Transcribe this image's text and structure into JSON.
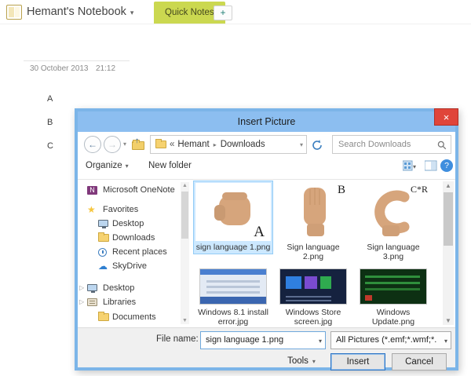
{
  "colors": {
    "dialog_frame": "#7cb5e8",
    "titlebar": "#8cbef0",
    "close_red": "#e0453a",
    "selection": "#cce8ff",
    "section_tab": "#cbd850",
    "onenote_purple": "#80397b"
  },
  "glyphs": {
    "back": "←",
    "forward": "→",
    "up": "↑",
    "dropdown": "▾",
    "chevron": "▸",
    "guillemet": "«",
    "star": "★",
    "cloud": "☁",
    "close": "×",
    "plus": "+",
    "help": "?",
    "scroll_up": "▲",
    "scroll_down": "▼",
    "expander": "▷",
    "onenote_n": "N"
  },
  "app": {
    "notebook_title": "Hemant's Notebook",
    "section_tab": "Quick Notes",
    "date": "30 October 2013",
    "time": "21:12",
    "outline_items": [
      "A",
      "B",
      "C"
    ]
  },
  "dialog": {
    "title": "Insert Picture",
    "nav": {
      "breadcrumb_items": [
        "Hemant",
        "Downloads"
      ],
      "search_placeholder": "Search Downloads"
    },
    "toolbar": {
      "organize": "Organize",
      "new_folder": "New folder"
    },
    "sidebar": {
      "items": [
        {
          "label": "Microsoft OneNote",
          "icon": "onenote"
        },
        {
          "label": "Favorites",
          "icon": "star"
        },
        {
          "label": "Desktop",
          "icon": "monitor"
        },
        {
          "label": "Downloads",
          "icon": "folder"
        },
        {
          "label": "Recent places",
          "icon": "clock"
        },
        {
          "label": "SkyDrive",
          "icon": "cloud"
        },
        {
          "label": "Desktop",
          "icon": "monitor"
        },
        {
          "label": "Libraries",
          "icon": "library"
        },
        {
          "label": "Documents",
          "icon": "folder"
        }
      ]
    },
    "files": [
      {
        "name": "sign language 1.png",
        "letter": "A",
        "selected": true
      },
      {
        "name": "Sign language 2.png",
        "letter": "B",
        "selected": false
      },
      {
        "name": "Sign language 3.png",
        "letter": "C*R",
        "selected": false
      },
      {
        "name": "Windows 8.1 install error.jpg",
        "selected": false
      },
      {
        "name": "Windows Store screen.jpg",
        "selected": false
      },
      {
        "name": "Windows Update.png",
        "selected": false
      }
    ],
    "footer": {
      "file_name_label": "File name:",
      "file_name_value": "sign language 1.png",
      "file_type_value": "All Pictures (*.emf;*.wmf;*.jpg;",
      "tools": "Tools",
      "insert": "Insert",
      "cancel": "Cancel"
    }
  }
}
